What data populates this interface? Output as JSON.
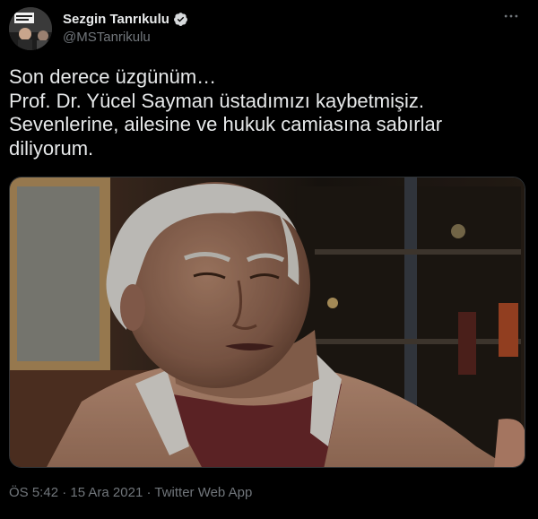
{
  "author": {
    "display_name": "Sezgin Tanrıkulu",
    "handle": "@MSTanrikulu",
    "verified": true
  },
  "tweet": {
    "text": "Son derece üzgünüm…\nProf. Dr. Yücel Sayman üstadımızı kaybetmişiz.\nSevenlerine, ailesine ve hukuk camiasına sabırlar\ndiliyorum."
  },
  "meta": {
    "time": "ÖS 5:42",
    "separator": " · ",
    "date": "15 Ara 2021",
    "app": "Twitter Web App"
  },
  "icons": {
    "verified": "verified-badge-icon",
    "more": "more-horizontal-icon"
  },
  "colors": {
    "background": "#000000",
    "text": "#e7e9ea",
    "secondary": "#71767b",
    "verified_badge": "#d6d9db"
  }
}
